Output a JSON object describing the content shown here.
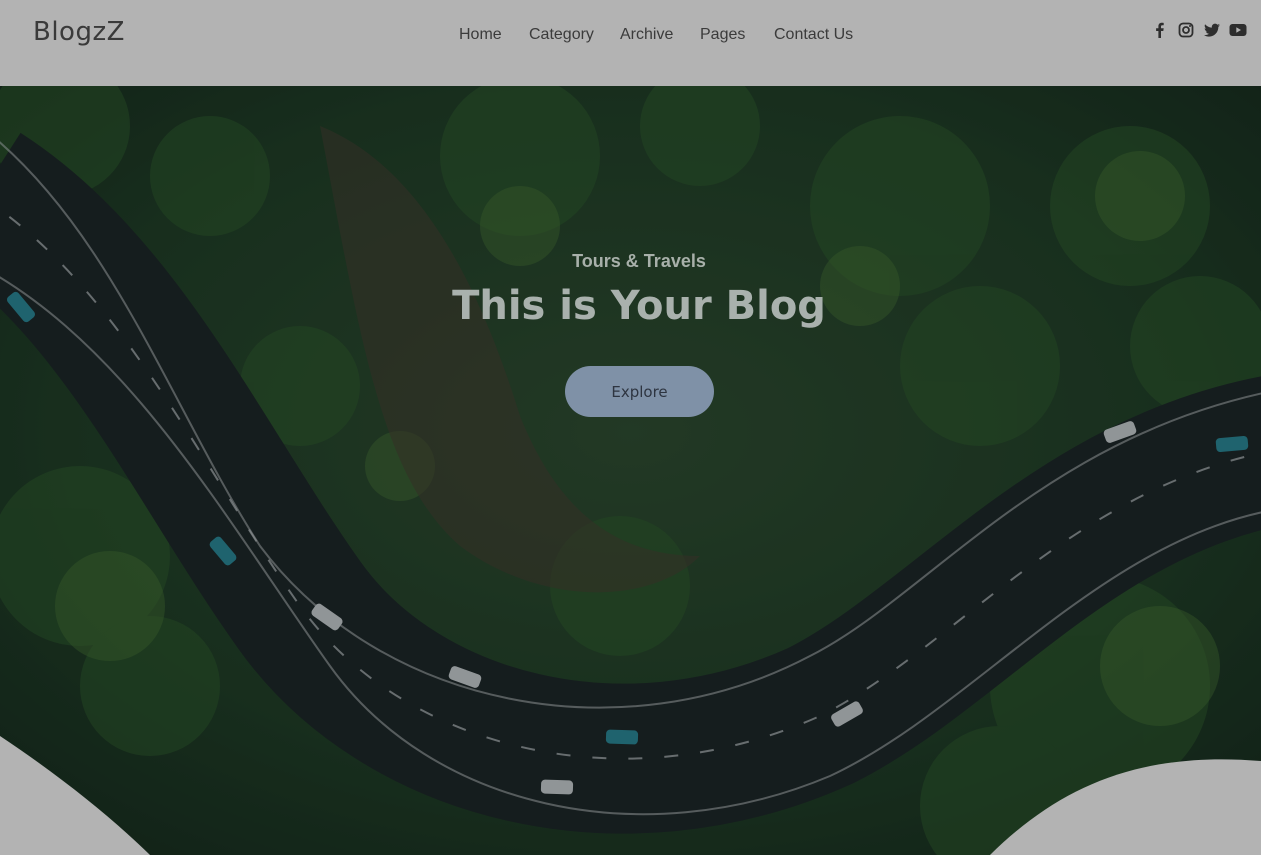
{
  "brand": {
    "name": "BlogzZ"
  },
  "nav": {
    "items": [
      "Home",
      "Category",
      "Archive",
      "Pages",
      "Contact Us"
    ]
  },
  "socials": {
    "icons": [
      "facebook-icon",
      "instagram-icon",
      "twitter-icon",
      "youtube-icon"
    ]
  },
  "hero": {
    "subtitle": "Tours & Travels",
    "title": "This is Your Blog",
    "button_label": "Explore"
  },
  "colors": {
    "page_bg": "#b3b3b3",
    "text_dark": "#3a3a3a",
    "button_bg": "#7f91a7",
    "hero_text": "#a9b1ad"
  }
}
